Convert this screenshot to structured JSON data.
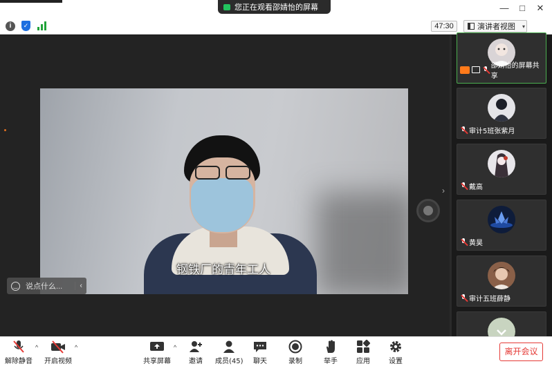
{
  "banner": {
    "text": "您正在观看邵婧怡的屏幕"
  },
  "window": {
    "minimize": "—",
    "maximize": "□",
    "close": "✕"
  },
  "subbar": {
    "timer": "47:30",
    "view_label": "演讲者视图",
    "view_chevron": "▾",
    "info_glyph": "i",
    "shield_glyph": "✓"
  },
  "stage": {
    "subtitle": "钢铁厂的青年工人",
    "chat_placeholder": "说点什么...",
    "chat_collapse": "‹",
    "expand_arrow": "›"
  },
  "participants": [
    {
      "name": "邵婧怡的屏幕共享",
      "sharing": true,
      "avatar_color": "#d9d4d6"
    },
    {
      "name": "审计5班张紫月",
      "sharing": false,
      "avatar_color": "#2f3340"
    },
    {
      "name": "戴高",
      "sharing": false,
      "avatar_color": "#e8e6ea"
    },
    {
      "name": "黄昊",
      "sharing": false,
      "avatar_color": "#1f4aa0"
    },
    {
      "name": "审计五班薛静",
      "sharing": false,
      "avatar_color": "#8a6048"
    },
    {
      "name": "",
      "sharing": false,
      "avatar_color": "#5a7a52"
    }
  ],
  "toolbar": {
    "unmute": "解除静音",
    "start_video": "开启视频",
    "share_screen": "共享屏幕",
    "invite": "邀请",
    "members": "成员(45)",
    "chat": "聊天",
    "record": "录制",
    "raise_hand": "举手",
    "apps": "应用",
    "settings": "设置",
    "leave": "离开会议",
    "caret": "^"
  },
  "colors": {
    "accent_green": "#22c55e",
    "leave_red": "#e53935",
    "share_orange": "#ff7a1a"
  }
}
